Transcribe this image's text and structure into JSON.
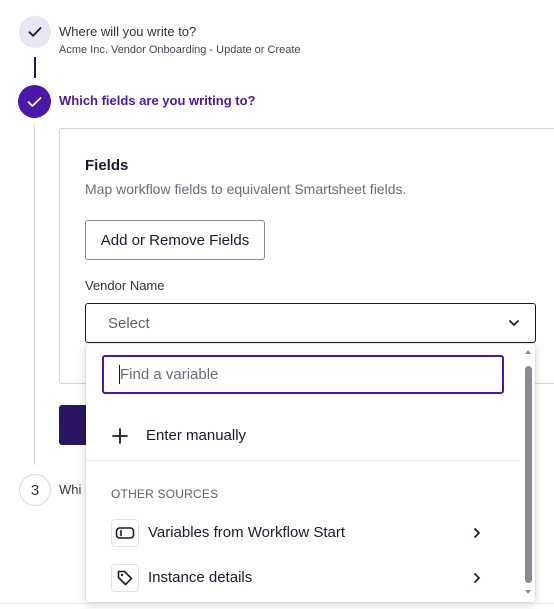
{
  "steps": [
    {
      "state": "completed",
      "title": "Where will you write to?",
      "subtitle": "Acme Inc. Vendor Onboarding - Update or Create"
    },
    {
      "state": "active",
      "title": "Which fields are you writing to?"
    },
    {
      "state": "pending",
      "number": "3",
      "title": "Whi"
    }
  ],
  "fields_panel": {
    "heading": "Fields",
    "description": "Map workflow fields to equivalent Smartsheet fields.",
    "add_remove_label": "Add or Remove Fields",
    "vendor_label": "Vendor Name",
    "select_value": "Select"
  },
  "dropdown": {
    "search_placeholder": "Find a variable",
    "search_value": "",
    "enter_manually_label": "Enter manually",
    "section_label": "OTHER SOURCES",
    "sources": [
      {
        "label": "Variables from Workflow Start",
        "icon": "variable-box-icon"
      },
      {
        "label": "Instance details",
        "icon": "tag-icon"
      }
    ]
  },
  "colors": {
    "accent": "#4a17a8",
    "accent_dark": "#2a1660",
    "completed_bg": "#e9e5f5"
  }
}
